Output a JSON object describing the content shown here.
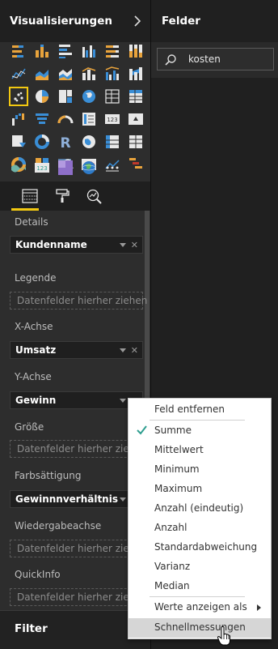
{
  "visualizations": {
    "title": "Visualisierungen"
  },
  "fields_pane": {
    "title": "Felder",
    "search_value": "kosten"
  },
  "wells": {
    "details": {
      "label": "Details",
      "field": "Kundenname"
    },
    "legend": {
      "label": "Legende",
      "placeholder": "Datenfelder hierher ziehen"
    },
    "x_axis": {
      "label": "X-Achse",
      "field": "Umsatz"
    },
    "y_axis": {
      "label": "Y-Achse",
      "field": "Gewinn"
    },
    "size": {
      "label": "Größe",
      "placeholder": "Datenfelder hierher ziehen"
    },
    "saturation": {
      "label": "Farbsättigung",
      "field": "Gewinnnverhältnis"
    },
    "play_axis": {
      "label": "Wiedergabeachse",
      "placeholder": "Datenfelder hierher ziehen"
    },
    "tooltip": {
      "label": "QuickInfo",
      "placeholder": "Datenfelder hierher ziehen"
    }
  },
  "filter": {
    "title": "Filter"
  },
  "context_menu": {
    "items": [
      "Feld entfernen",
      "Summe",
      "Mittelwert",
      "Minimum",
      "Maximum",
      "Anzahl (eindeutig)",
      "Anzahl",
      "Standardabweichung",
      "Varianz",
      "Median",
      "Werte anzeigen als",
      "Schnellmessungen"
    ],
    "checked_item": "Summe",
    "highlighted_item": "Schnellmessungen"
  },
  "colors": {
    "accent": "#f2c811",
    "check": "#2e9e8f",
    "menu_highlight": "#d6d6d6"
  },
  "gallery_icons": [
    "stacked-bar-icon",
    "stacked-column-icon",
    "clustered-bar-icon",
    "clustered-column-icon",
    "100-bar-icon",
    "100-column-icon",
    "line-icon",
    "area-icon",
    "stacked-area-icon",
    "line-column-icon",
    "line-clustered-column-icon",
    "ribbon-icon",
    "scatter-icon",
    "pie-icon",
    "treemap-icon",
    "map-icon",
    "table-icon",
    "matrix-icon",
    "waterfall-icon",
    "funnel-icon",
    "gauge-icon",
    "multirow-card-icon",
    "card-icon",
    "kpi-icon",
    "slicer-icon",
    "donut-icon",
    "r-visual-icon",
    "filled-map-icon",
    "matrix2-icon",
    "table2-icon",
    "donut-custom-icon",
    "grid-custom-icon",
    "image-search-icon",
    "sparkline-icon",
    "line-custom-icon",
    "gantt-icon",
    "flow-icon",
    "card-123-icon",
    "purple-tile-icon",
    "globe-icon",
    "more-icon"
  ]
}
